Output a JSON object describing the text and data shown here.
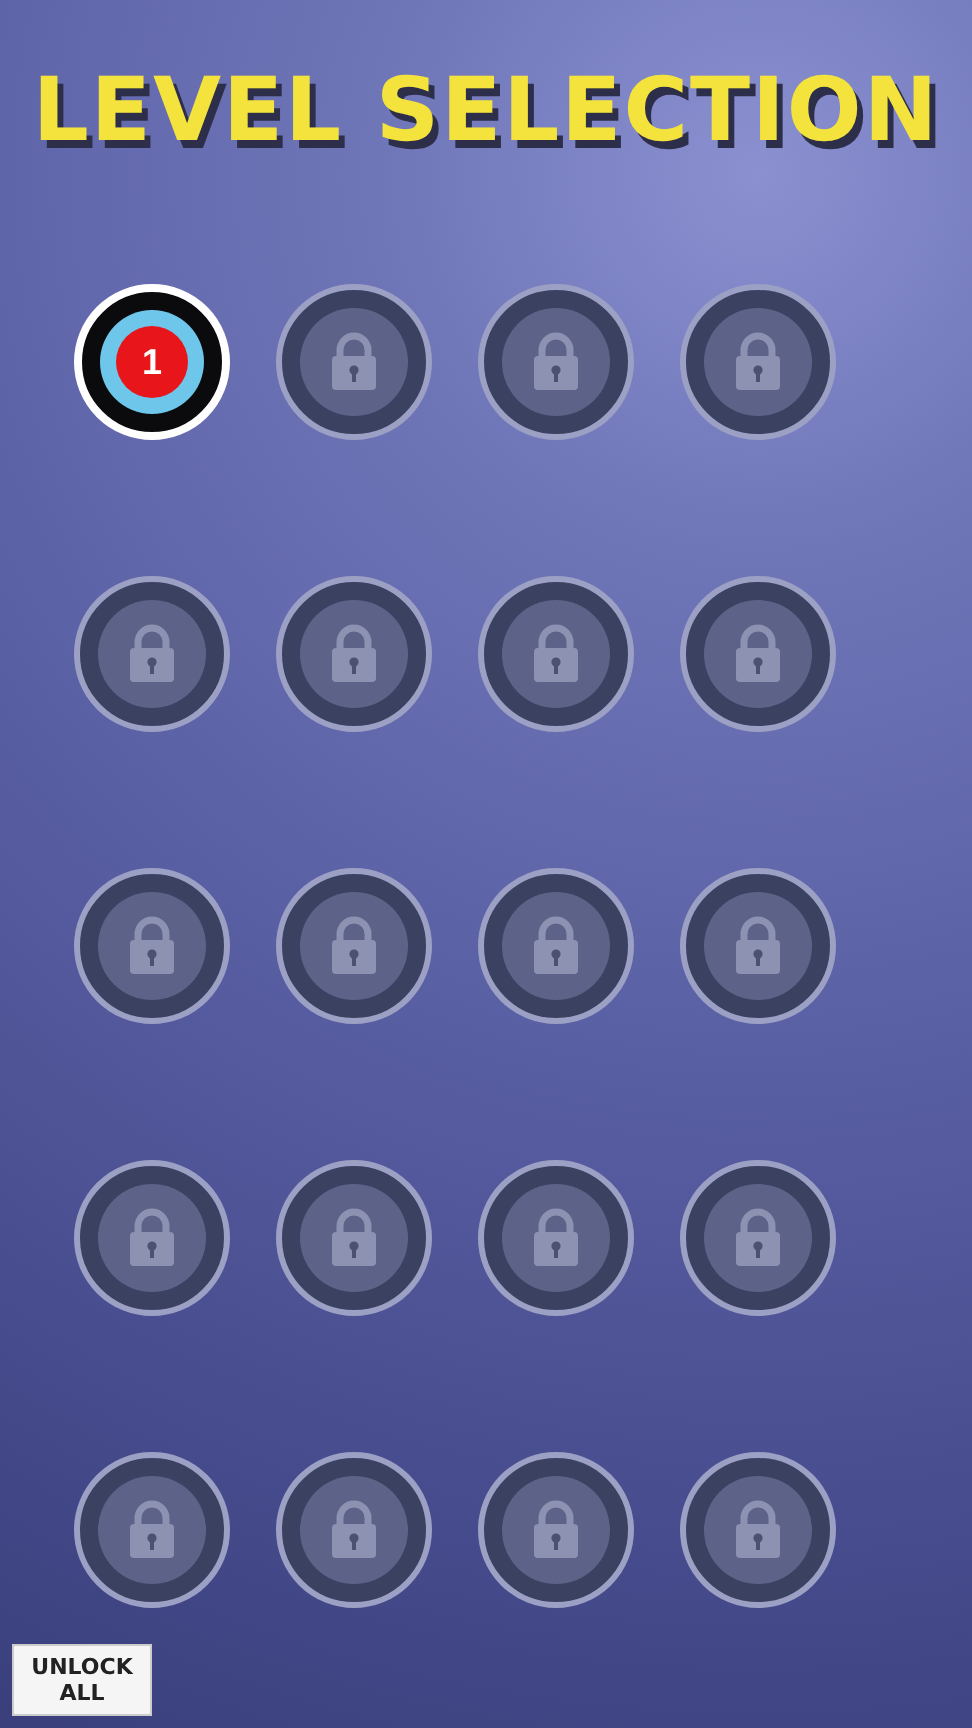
{
  "title": "LEVEL SELECTION",
  "levels": [
    {
      "label": "1",
      "locked": false
    },
    {
      "locked": true
    },
    {
      "locked": true
    },
    {
      "locked": true
    },
    {
      "locked": true
    },
    {
      "locked": true
    },
    {
      "locked": true
    },
    {
      "locked": true
    },
    {
      "locked": true
    },
    {
      "locked": true
    },
    {
      "locked": true
    },
    {
      "locked": true
    },
    {
      "locked": true
    },
    {
      "locked": true
    },
    {
      "locked": true
    },
    {
      "locked": true
    },
    {
      "locked": true
    },
    {
      "locked": true
    },
    {
      "locked": true
    },
    {
      "locked": true
    }
  ],
  "unlock_button": "UNLOCK ALL"
}
